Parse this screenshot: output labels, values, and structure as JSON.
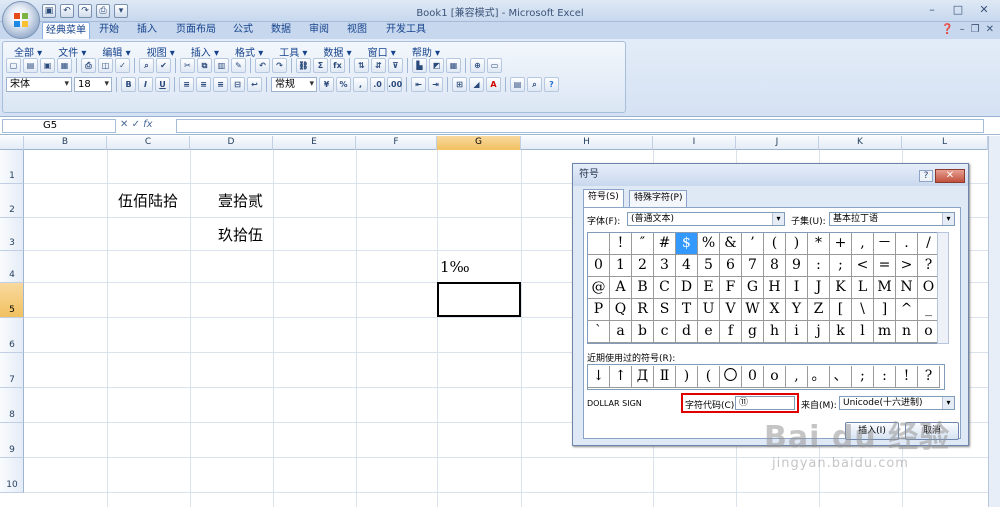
{
  "window": {
    "title": "Book1  [兼容模式] - Microsoft Excel",
    "controls": [
      "–",
      "□",
      "✕"
    ]
  },
  "qat": {
    "items": [
      "save",
      "undo",
      "redo",
      "print",
      "customize"
    ]
  },
  "tabs": [
    "经典菜单",
    "开始",
    "插入",
    "页面布局",
    "公式",
    "数据",
    "审阅",
    "视图",
    "开发工具"
  ],
  "menu": [
    "全部 ▾",
    "文件 ▾",
    "编辑 ▾",
    "视图 ▾",
    "插入 ▾",
    "格式 ▾",
    "工具 ▾",
    "数据 ▾",
    "窗口 ▾",
    "帮助 ▾"
  ],
  "toolbar": {
    "font": "宋体",
    "size": "18",
    "number_format": "常规",
    "bold": "B",
    "italic": "I",
    "underline": "U",
    "sum": "Σ",
    "fx": "fx",
    "percent": "%"
  },
  "formula_bar": {
    "name_box": "G5",
    "fx_label": "fx",
    "formula": ""
  },
  "sheet": {
    "columns": [
      "B",
      "C",
      "D",
      "E",
      "F",
      "G",
      "H",
      "I",
      "J",
      "K",
      "L"
    ],
    "selected_column": "G",
    "rows": [
      "1",
      "2",
      "3",
      "4",
      "5",
      "6",
      "7",
      "8",
      "9",
      "10"
    ],
    "selected_row": "5",
    "cells": {
      "C2": "伍佰陆拾",
      "D2": "壹拾贰",
      "D3": "玖拾伍",
      "G4": "1‰"
    }
  },
  "dialog": {
    "title": "符号",
    "help": "?",
    "close": "✕",
    "tabs": [
      "符号(S)",
      "特殊字符(P)"
    ],
    "font_label": "字体(F):",
    "font_value": "(普通文本)",
    "subset_label": "子集(U):",
    "subset_value": "基本拉丁语",
    "symbols": [
      [
        " ",
        "!",
        "″",
        "#",
        "$",
        "%",
        "&",
        "’",
        "(",
        ")",
        "*",
        "+",
        ",",
        "－",
        ".",
        "/"
      ],
      [
        "0",
        "1",
        "2",
        "3",
        "4",
        "5",
        "6",
        "7",
        "8",
        "9",
        ":",
        ";",
        "<",
        "=",
        ">",
        "?"
      ],
      [
        "@",
        "A",
        "B",
        "C",
        "D",
        "E",
        "F",
        "G",
        "H",
        "I",
        "J",
        "K",
        "L",
        "M",
        "N",
        "O"
      ],
      [
        "P",
        "Q",
        "R",
        "S",
        "T",
        "U",
        "V",
        "W",
        "X",
        "Y",
        "Z",
        "[",
        "\\",
        "]",
        "^",
        "_"
      ],
      [
        "`",
        "a",
        "b",
        "c",
        "d",
        "e",
        "f",
        "g",
        "h",
        "i",
        "j",
        "k",
        "l",
        "m",
        "n",
        "o"
      ]
    ],
    "selected_symbol": "$",
    "recent_label": "近期使用过的符号(R):",
    "recent": [
      "↓",
      "↑",
      "Д",
      "Ⅱ",
      ")",
      "(",
      "〇",
      "0",
      "o",
      ",",
      "。",
      "、",
      ";",
      ":",
      "!",
      "?"
    ],
    "unicode_name": "DOLLAR SIGN",
    "code_label": "字符代码(C):",
    "code_value": "⑪",
    "from_label": "来自(M):",
    "from_value": "Unicode(十六进制)",
    "insert_button": "插入(I)",
    "cancel_button": "取消"
  },
  "watermark": {
    "brand": "Bai du 经验",
    "url": "jingyan.baidu.com"
  },
  "colors": {
    "selected_header": "#f1c15f",
    "highlight_symbol": "#3399ff",
    "annotation_red": "#e00000"
  }
}
